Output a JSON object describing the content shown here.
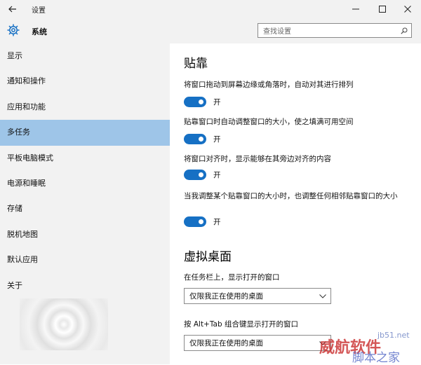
{
  "window": {
    "title": "设置",
    "back_icon": "back-arrow-icon",
    "controls": [
      "minimize-icon",
      "maximize-icon",
      "close-icon"
    ]
  },
  "sidebar": {
    "header": {
      "icon": "gear-icon",
      "title": "系统"
    },
    "items": [
      {
        "label": "显示"
      },
      {
        "label": "通知和操作"
      },
      {
        "label": "应用和功能"
      },
      {
        "label": "多任务",
        "selected": true
      },
      {
        "label": "平板电脑模式"
      },
      {
        "label": "电源和睡眠"
      },
      {
        "label": "存储"
      },
      {
        "label": "脱机地图"
      },
      {
        "label": "默认应用"
      },
      {
        "label": "关于"
      }
    ]
  },
  "search": {
    "placeholder": "查找设置",
    "icon": "search-icon"
  },
  "snap": {
    "title": "贴靠",
    "options": [
      {
        "label": "将窗口拖动到屏幕边缘或角落时，自动对其进行排列",
        "state": "开"
      },
      {
        "label": "贴靠窗口时自动调整窗口的大小，使之填满可用空间",
        "state": "开"
      },
      {
        "label": "将窗口对齐时，显示能够在其旁边对齐的内容",
        "state": "开"
      },
      {
        "label": "当我调整某个贴靠窗口的大小时，也调整任何相邻贴靠窗口的大小",
        "state": "开"
      }
    ]
  },
  "virtual_desktops": {
    "title": "虚拟桌面",
    "taskbar": {
      "label": "在任务栏上，显示打开的窗口",
      "value": "仅限我正在使用的桌面"
    },
    "alttab": {
      "label": "按 Alt+Tab 组合键显示打开的窗口",
      "value": "仅限我正在使用的桌面"
    }
  },
  "watermark": {
    "big": "威航软件",
    "small": "jb51.net",
    "sub": "脚本之家"
  },
  "colors": {
    "accent": "#1670c4",
    "selected": "#9ec5e8",
    "sidebar_bg": "#f2f2f2"
  }
}
